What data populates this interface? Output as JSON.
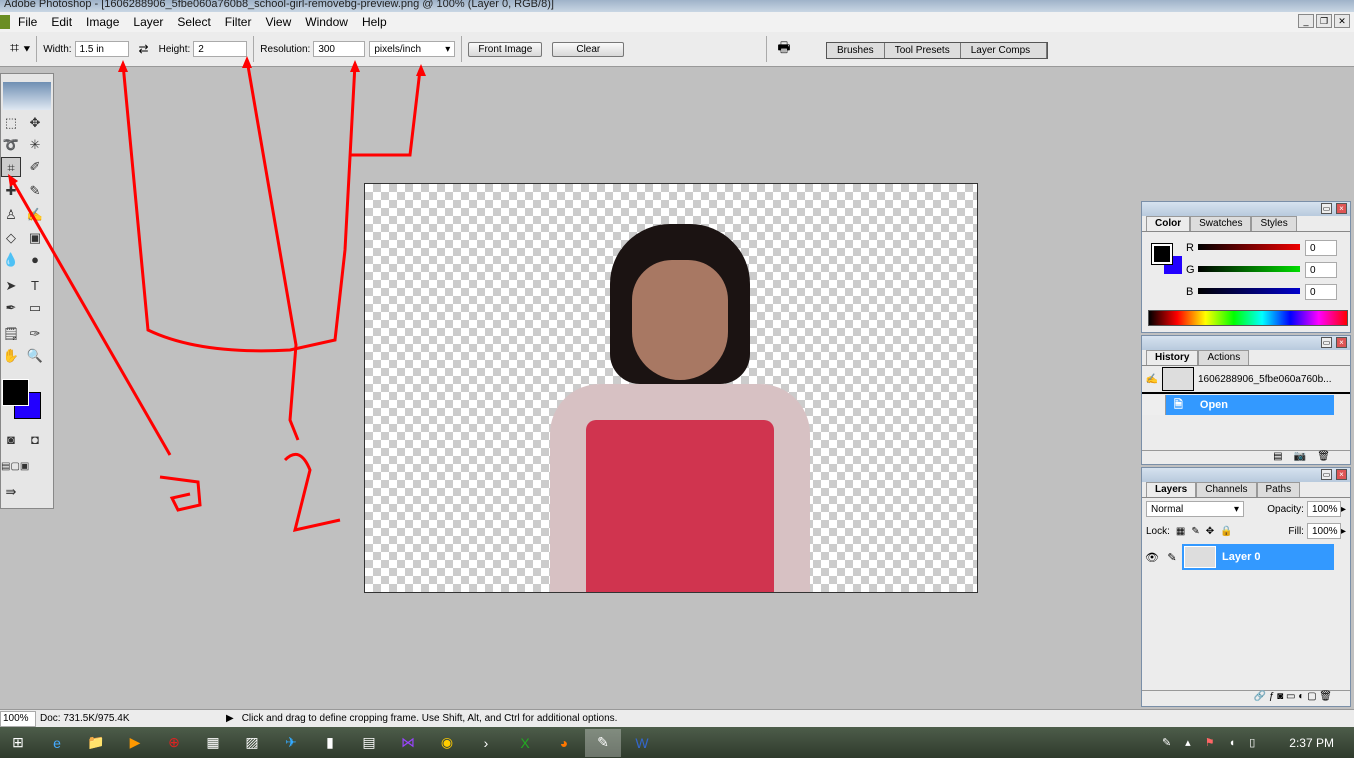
{
  "window": {
    "title": "Adobe Photoshop - [1606288906_5fbe060a760b8_school-girl-removebg-preview.png @ 100% (Layer 0, RGB/8)]"
  },
  "menu": [
    "File",
    "Edit",
    "Image",
    "Layer",
    "Select",
    "Filter",
    "View",
    "Window",
    "Help"
  ],
  "options": {
    "width_label": "Width:",
    "width_value": "1.5 in",
    "height_label": "Height:",
    "height_value": "2",
    "resolution_label": "Resolution:",
    "resolution_value": "300",
    "resolution_unit": "pixels/inch",
    "front_image": "Front Image",
    "clear": "Clear"
  },
  "wells": [
    "Brushes",
    "Tool Presets",
    "Layer Comps"
  ],
  "color_panel": {
    "tabs": [
      "Color",
      "Swatches",
      "Styles"
    ],
    "r_label": "R",
    "g_label": "G",
    "b_label": "B",
    "r": "0",
    "g": "0",
    "b": "0"
  },
  "history_panel": {
    "tabs": [
      "History",
      "Actions"
    ],
    "snapshot": "1606288906_5fbe060a760b...",
    "step": "Open"
  },
  "layers_panel": {
    "tabs": [
      "Layers",
      "Channels",
      "Paths"
    ],
    "blend": "Normal",
    "opacity_label": "Opacity:",
    "opacity": "100%",
    "lock_label": "Lock:",
    "fill_label": "Fill:",
    "fill": "100%",
    "layer": "Layer 0"
  },
  "status": {
    "zoom": "100%",
    "doc": "Doc: 731.5K/975.4K",
    "hint": "Click and drag to define cropping frame. Use Shift, Alt, and Ctrl for additional options."
  },
  "taskbar": {
    "time": "2:37 PM"
  },
  "colors": {
    "accent": "#3399ff",
    "foreground": "#000000",
    "background": "#2200ff",
    "annotation": "#ff0000"
  }
}
